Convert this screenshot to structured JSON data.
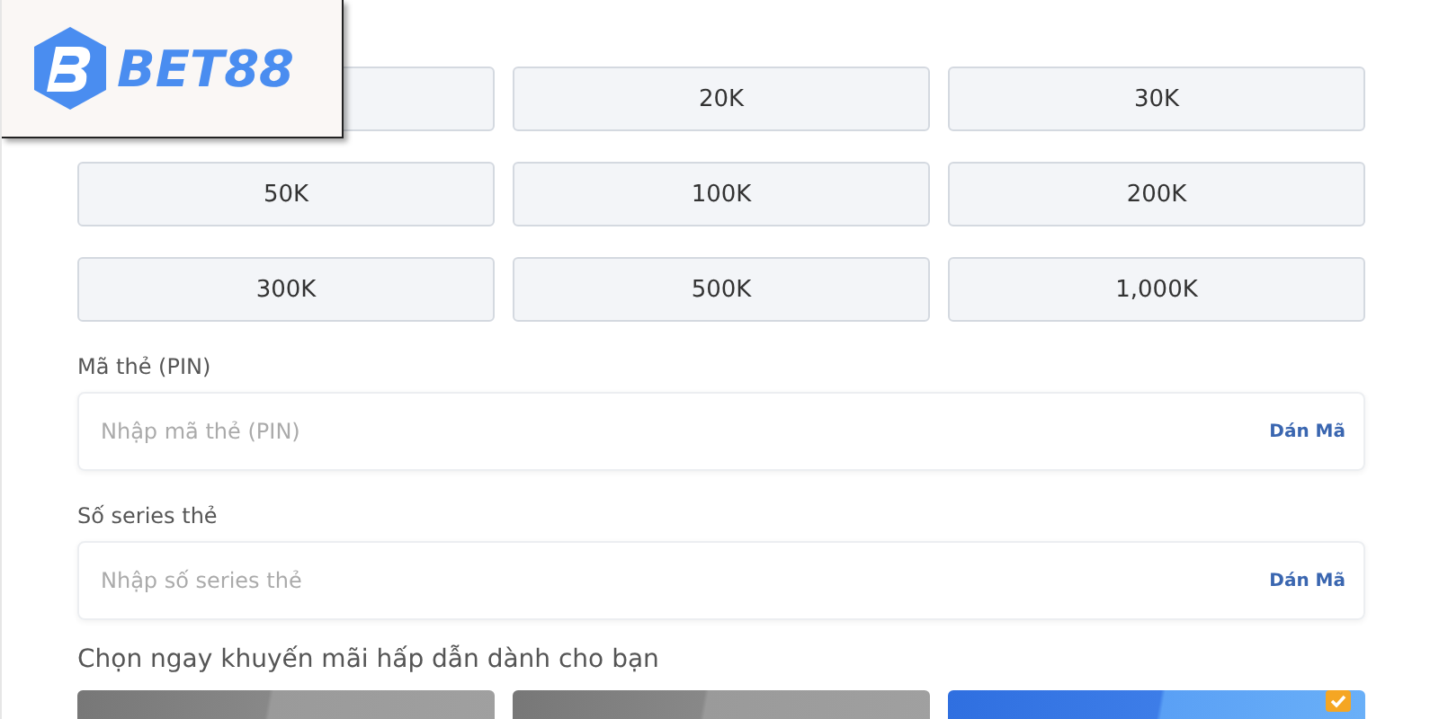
{
  "logo": {
    "text": "BET88"
  },
  "amounts": [
    {
      "kind": "covered"
    },
    {
      "kind": "amount",
      "label": "20K"
    },
    {
      "kind": "amount",
      "label": "30K"
    },
    {
      "kind": "amount",
      "label": "50K"
    },
    {
      "kind": "amount",
      "label": "100K"
    },
    {
      "kind": "amount",
      "label": "200K"
    },
    {
      "kind": "amount",
      "label": "300K"
    },
    {
      "kind": "amount",
      "label": "500K"
    },
    {
      "kind": "amount",
      "label": "1,000K"
    }
  ],
  "fields": [
    {
      "label": "Mã thẻ (PIN)",
      "placeholder": "Nhập mã thẻ (PIN)",
      "action": "Dán Mã"
    },
    {
      "label": "Số series thẻ",
      "placeholder": "Nhập số series thẻ",
      "action": "Dán Mã"
    }
  ],
  "promo_heading": "Chọn ngay khuyến mãi hấp dẫn dành cho bạn",
  "promos": [
    {
      "selected": false
    },
    {
      "selected": false
    },
    {
      "selected": true
    }
  ]
}
